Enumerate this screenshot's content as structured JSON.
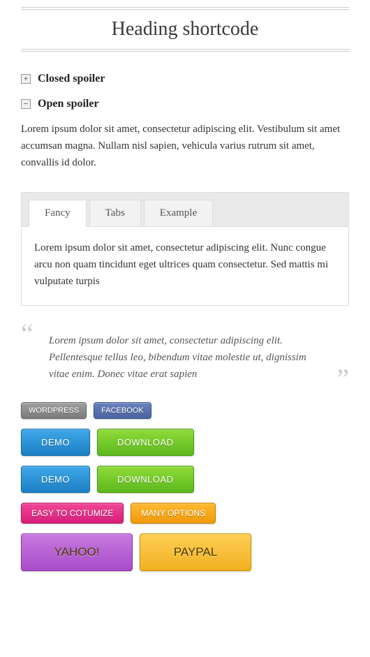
{
  "heading": "Heading shortcode",
  "spoilers": {
    "closed": {
      "title": "Closed spoiler",
      "icon": "+"
    },
    "open": {
      "title": "Open spoiler",
      "icon": "−",
      "body": "Lorem ipsum dolor sit amet, consectetur adipiscing elit. Vestibulum sit amet accumsan magna. Nullam nisl sapien, vehicula varius rutrum sit amet, convallis id dolor."
    }
  },
  "tabs": {
    "items": [
      "Fancy",
      "Tabs",
      "Example"
    ],
    "active_index": 0,
    "panel": "Lorem ipsum dolor sit amet, consectetur adipiscing elit. Nunc congue arcu non quam tincidunt eget ultrices quam consectetur. Sed mattis mi vulputate turpis"
  },
  "quote": "Lorem ipsum dolor sit amet, consectetur adipiscing elit. Pellentesque tellus leo, bibendum vitae molestie ut, dignissim vitae enim. Donec vitae erat sapien",
  "buttons": {
    "row1": [
      "WORDPRESS",
      "FACEBOOK"
    ],
    "row2": [
      "DEMO",
      "DOWNLOAD"
    ],
    "row3": [
      "DEMO",
      "DOWNLOAD"
    ],
    "row4": [
      "EASY TO COTUMIZE",
      "MANY OPTIONS"
    ],
    "row5": [
      "YAHOO!",
      "PAYPAL"
    ]
  }
}
